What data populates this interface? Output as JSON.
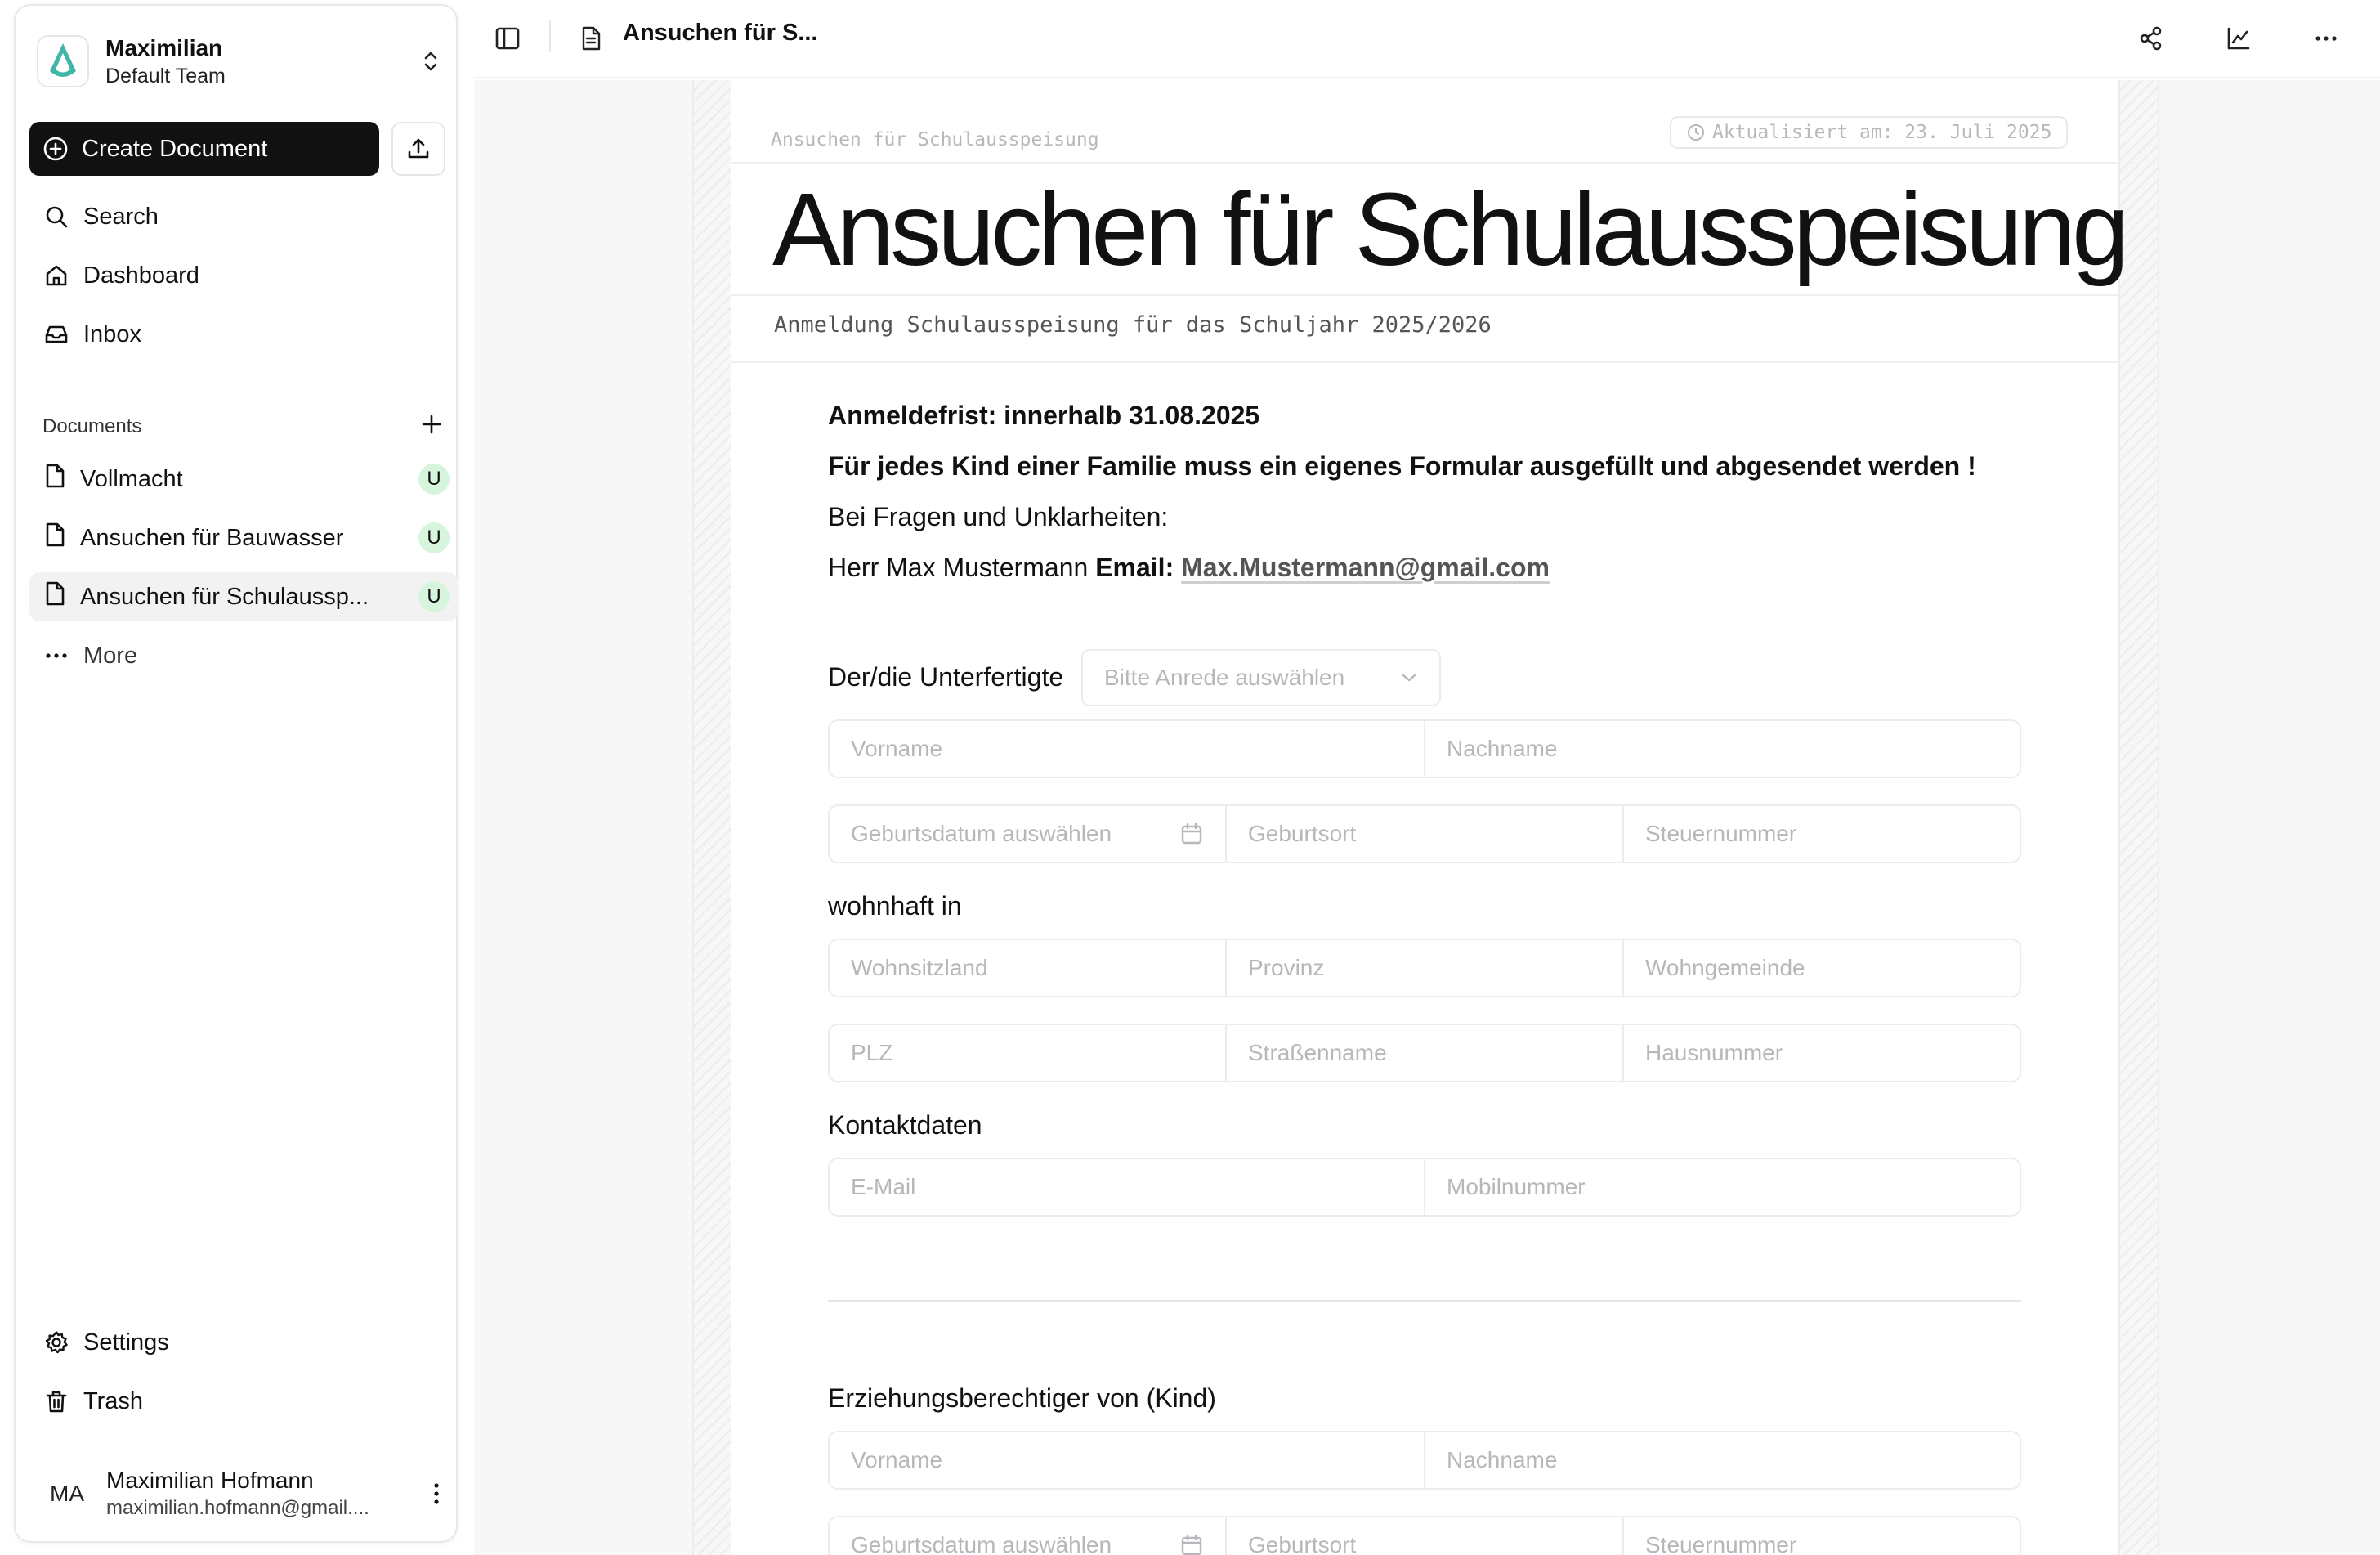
{
  "team": {
    "name": "Maximilian",
    "subtitle": "Default Team"
  },
  "sidebar": {
    "create_label": "Create Document",
    "nav": [
      {
        "label": "Search",
        "icon": "search-icon"
      },
      {
        "label": "Dashboard",
        "icon": "home-icon"
      },
      {
        "label": "Inbox",
        "icon": "inbox-icon"
      }
    ],
    "documents_header": "Documents",
    "documents": [
      {
        "label": "Vollmacht",
        "badge": "U"
      },
      {
        "label": "Ansuchen für Bauwasser",
        "badge": "U"
      },
      {
        "label": "Ansuchen für Schulaussp...",
        "badge": "U",
        "active": true
      }
    ],
    "more_label": "More",
    "settings_label": "Settings",
    "trash_label": "Trash",
    "user": {
      "initials": "MA",
      "name": "Maximilian Hofmann",
      "email": "maximilian.hofmann@gmail...."
    }
  },
  "topbar": {
    "title": "Ansuchen für S..."
  },
  "doc": {
    "breadcrumb": "Ansuchen für Schulausspeisung",
    "updated": "Aktualisiert am: 23. Juli 2025",
    "title": "Ansuchen für Schulausspeisung",
    "subtitle": "Anmeldung Schulausspeisung für das Schuljahr 2025/2026",
    "deadline": "Anmeldefrist: innerhalb 31.08.2025",
    "notice": "Für jedes Kind einer Familie muss ein eigenes Formular ausgefüllt und abgesendet werden !",
    "questions": "Bei Fragen und Unklarheiten:",
    "contact_name": "Herr Max Mustermann",
    "contact_email_label": "Email:",
    "contact_email": "Max.Mustermann@gmail.com"
  },
  "form": {
    "undersigned_label": "Der/die Unterfertigte",
    "salutation_placeholder": "Bitte Anrede auswählen",
    "firstname": "Vorname",
    "lastname": "Nachname",
    "birthdate": "Geburtsdatum auswählen",
    "birthplace": "Geburtsort",
    "taxnumber": "Steuernummer",
    "residence_label": "wohnhaft in",
    "country": "Wohnsitzland",
    "province": "Provinz",
    "municipality": "Wohngemeinde",
    "zip": "PLZ",
    "street": "Straßenname",
    "housenumber": "Hausnummer",
    "contact_label": "Kontaktdaten",
    "email": "E-Mail",
    "mobile": "Mobilnummer",
    "guardian_label": "Erziehungsberechtiger von (Kind)",
    "child_firstname": "Vorname",
    "child_lastname": "Nachname",
    "child_birthdate": "Geburtsdatum auswählen",
    "child_birthplace": "Geburtsort",
    "child_taxnumber": "Steuernummer"
  },
  "colors": {
    "primary": "#111111",
    "badge_bg": "#d6f5dc",
    "logo_teal": "#3fb6a8"
  }
}
